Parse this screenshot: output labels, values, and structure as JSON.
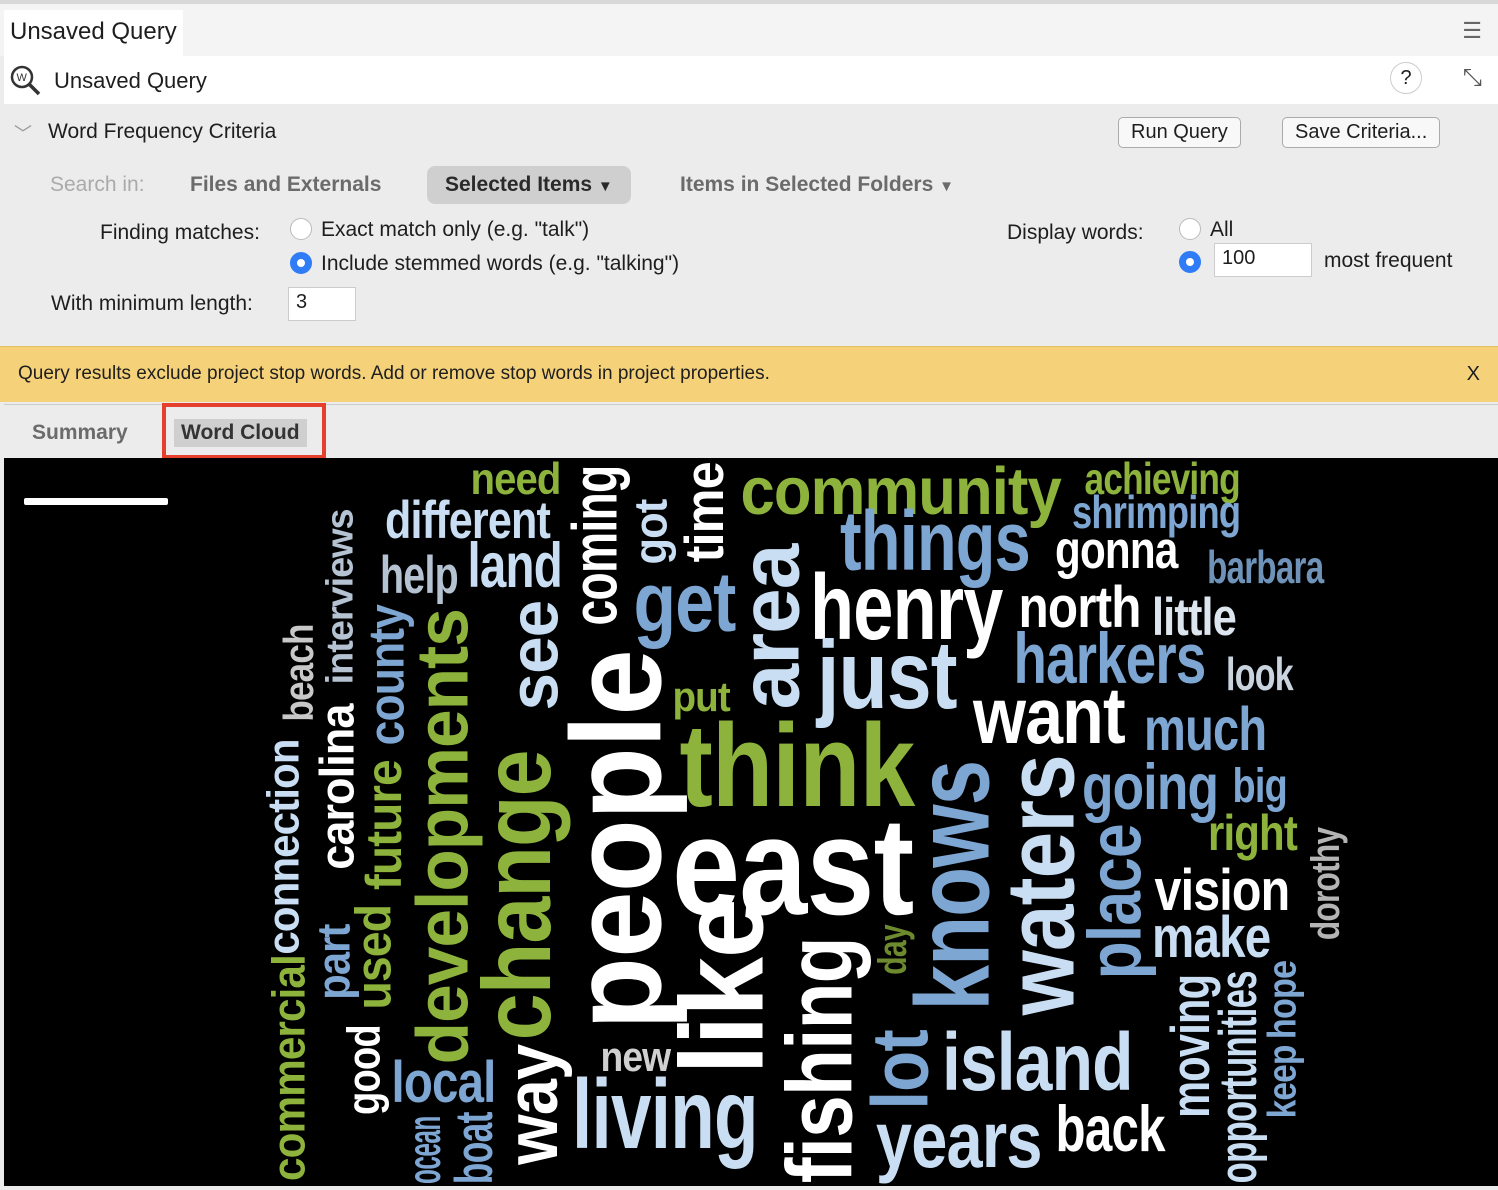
{
  "window": {
    "tab_title": "Unsaved Query",
    "menu_icon": "hamburger-icon"
  },
  "header": {
    "title": "Unsaved Query",
    "icon": "word-frequency-query-icon",
    "help": "?",
    "expand_icon": "expand-icon"
  },
  "criteria": {
    "title": "Word Frequency Criteria",
    "run_label": "Run Query",
    "save_label": "Save Criteria...",
    "search_in_label": "Search in:",
    "search_options": [
      "Files and Externals",
      "Selected Items",
      "Items in Selected Folders"
    ],
    "selected_search": "Selected Items",
    "finding_label": "Finding matches:",
    "exact_label": "Exact match only (e.g. \"talk\")",
    "stemmed_label": "Include stemmed words (e.g. \"talking\")",
    "finding_selected": "stemmed",
    "min_length_label": "With minimum length:",
    "min_length": "3",
    "display_label": "Display words:",
    "all_label": "All",
    "count": "100",
    "most_frequent_label": "most frequent",
    "display_selected": "count"
  },
  "banner": {
    "text": "Query results exclude project stop words. Add or remove stop words in project properties.",
    "close": "X",
    "color": "#f5d27a"
  },
  "tabs": {
    "summary": "Summary",
    "word_cloud": "Word Cloud",
    "active": "Word Cloud"
  },
  "cloud": {
    "colors": {
      "green": "#8db33c",
      "light": "#c9def2",
      "blue": "#7ea6d2",
      "white": "#ffffff",
      "gray": "#b4c2d2"
    },
    "words": [
      {
        "text": "need",
        "color": "#8db33c"
      },
      {
        "text": "community",
        "color": "#8db33c"
      },
      {
        "text": "achieving",
        "color": "#8db33c"
      },
      {
        "text": "shrimping",
        "color": "#7ea6d2"
      },
      {
        "text": "different",
        "color": "#c9def2"
      },
      {
        "text": "things",
        "color": "#7ea6d2"
      },
      {
        "text": "gonna",
        "color": "#ffffff"
      },
      {
        "text": "barbara",
        "color": "#6f93b8"
      },
      {
        "text": "help",
        "color": "#b4c2d2"
      },
      {
        "text": "land",
        "color": "#c9def2"
      },
      {
        "text": "get",
        "color": "#7ea6d2"
      },
      {
        "text": "henry",
        "color": "#ffffff"
      },
      {
        "text": "north",
        "color": "#ffffff"
      },
      {
        "text": "little",
        "color": "#dde6ee"
      },
      {
        "text": "harkers",
        "color": "#7ea6d2"
      },
      {
        "text": "just",
        "color": "#c9def2"
      },
      {
        "text": "look",
        "color": "#c9d4de"
      },
      {
        "text": "put",
        "color": "#8db33c"
      },
      {
        "text": "want",
        "color": "#ffffff"
      },
      {
        "text": "much",
        "color": "#7ea6d2"
      },
      {
        "text": "think",
        "color": "#8db33c"
      },
      {
        "text": "going",
        "color": "#7ea6d2"
      },
      {
        "text": "big",
        "color": "#7ea6d2"
      },
      {
        "text": "right",
        "color": "#8db33c"
      },
      {
        "text": "east",
        "color": "#ffffff"
      },
      {
        "text": "vision",
        "color": "#ffffff"
      },
      {
        "text": "make",
        "color": "#c9def2"
      },
      {
        "text": "new",
        "color": "#d0d0d0"
      },
      {
        "text": "local",
        "color": "#7ea6d2"
      },
      {
        "text": "living",
        "color": "#c9def2"
      },
      {
        "text": "island",
        "color": "#c9def2"
      },
      {
        "text": "years",
        "color": "#c9def2"
      },
      {
        "text": "back",
        "color": "#ffffff"
      },
      {
        "text": "interviews",
        "color": "#b4c2d2"
      },
      {
        "text": "beach",
        "color": "#c8c8c8"
      },
      {
        "text": "connection",
        "color": "#c9def2"
      },
      {
        "text": "commercial",
        "color": "#8db33c"
      },
      {
        "text": "carolina",
        "color": "#ffffff"
      },
      {
        "text": "part",
        "color": "#7ea6d2"
      },
      {
        "text": "good",
        "color": "#ffffff"
      },
      {
        "text": "county",
        "color": "#7ea6d2"
      },
      {
        "text": "future",
        "color": "#8db33c"
      },
      {
        "text": "used",
        "color": "#8db33c"
      },
      {
        "text": "developments",
        "color": "#8db33c"
      },
      {
        "text": "see",
        "color": "#c9def2"
      },
      {
        "text": "change",
        "color": "#8db33c"
      },
      {
        "text": "way",
        "color": "#ffffff"
      },
      {
        "text": "coming",
        "color": "#ffffff"
      },
      {
        "text": "people",
        "color": "#ffffff"
      },
      {
        "text": "got",
        "color": "#c9def2"
      },
      {
        "text": "time",
        "color": "#ffffff"
      },
      {
        "text": "area",
        "color": "#c9def2"
      },
      {
        "text": "like",
        "color": "#ffffff"
      },
      {
        "text": "fishing",
        "color": "#ffffff"
      },
      {
        "text": "day",
        "color": "#6e8a2e"
      },
      {
        "text": "lot",
        "color": "#7ea6d2"
      },
      {
        "text": "knows",
        "color": "#7ea6d2"
      },
      {
        "text": "waters",
        "color": "#c9def2"
      },
      {
        "text": "place",
        "color": "#7ea6d2"
      },
      {
        "text": "moving",
        "color": "#c9def2"
      },
      {
        "text": "opportunities",
        "color": "#c9def2"
      },
      {
        "text": "keep",
        "color": "#7ea6d2"
      },
      {
        "text": "hope",
        "color": "#7ea6d2"
      },
      {
        "text": "dorothy",
        "color": "#b4b4b4"
      },
      {
        "text": "boat",
        "color": "#7ea6d2"
      },
      {
        "text": "ocean",
        "color": "#7ea6d2"
      }
    ]
  }
}
